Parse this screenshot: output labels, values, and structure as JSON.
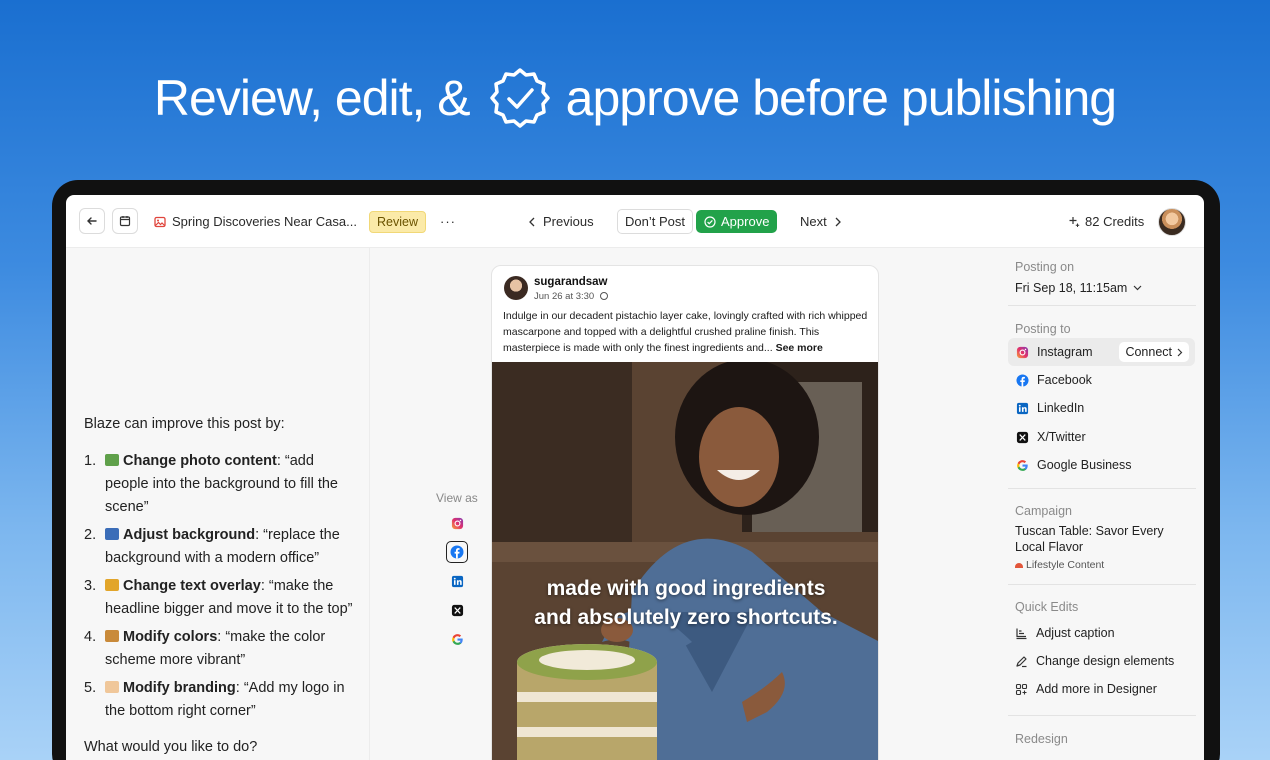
{
  "hero": {
    "before": "Review, edit, &",
    "after": "approve before publishing"
  },
  "topbar": {
    "post_title": "Spring Discoveries Near Casa...",
    "status": "Review",
    "more": "···",
    "previous": "Previous",
    "dont_post": "Don’t Post",
    "approve": "Approve",
    "next": "Next",
    "credits": "82 Credits"
  },
  "chat": {
    "intro": "Blaze can improve this post by:",
    "suggestions": [
      {
        "num": "1.",
        "title": "Change photo content",
        "text": ": “add people into the background to fill the scene”",
        "emoji_color": "#5fa04a"
      },
      {
        "num": "2.",
        "title": "Adjust background",
        "text": ": “replace the background with a modern office”",
        "emoji_color": "#3b6db8"
      },
      {
        "num": "3.",
        "title": "Change text overlay",
        "text": ": “make the headline bigger and move it to the top”",
        "emoji_color": "#e2a52a"
      },
      {
        "num": "4.",
        "title": "Modify colors",
        "text": ": “make the color scheme more vibrant”",
        "emoji_color": "#c98a3a"
      },
      {
        "num": "5.",
        "title": "Modify branding",
        "text": ": “Add my logo in the bottom right corner”",
        "emoji_color": "#f0c79a"
      }
    ],
    "question": "What would you like to do?"
  },
  "preview": {
    "view_as_label": "View as",
    "username": "sugarandsaw",
    "date": "Jun 26 at 3:30",
    "caption": "Indulge in our decadent pistachio layer cake, lovingly crafted with rich whipped mascarpone and topped with a delightful crushed praline finish. This masterpiece is made with only the finest ingredients and...",
    "see_more": "See more",
    "overlay_line1": "made with good ingredients",
    "overlay_line2": "and absolutely zero shortcuts."
  },
  "sidebar": {
    "posting_on_label": "Posting on",
    "posting_on_value": "Fri Sep 18, 11:15am",
    "posting_to_label": "Posting to",
    "platforms": [
      {
        "name": "Instagram",
        "icon": "instagram-icon",
        "color": "#e1306c"
      },
      {
        "name": "Facebook",
        "icon": "facebook-icon",
        "color": "#1877f2"
      },
      {
        "name": "LinkedIn",
        "icon": "linkedin-icon",
        "color": "#0a66c2"
      },
      {
        "name": "X/Twitter",
        "icon": "x-icon",
        "color": "#111111"
      },
      {
        "name": "Google Business",
        "icon": "google-icon",
        "color": "#4285f4"
      }
    ],
    "connect": "Connect",
    "campaign_label": "Campaign",
    "campaign_name": "Tuscan Table: Savor Every Local Flavor",
    "campaign_tag": "Lifestyle Content",
    "quick_edits_label": "Quick Edits",
    "quick_edits": [
      "Adjust caption",
      "Change design elements",
      "Add more in Designer"
    ],
    "redesign_label": "Redesign"
  }
}
